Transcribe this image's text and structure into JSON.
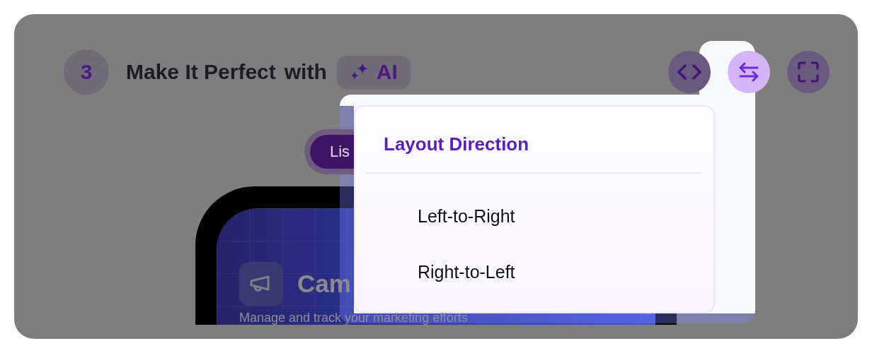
{
  "header": {
    "step": "3",
    "title": "Make It Perfect",
    "connector": "with",
    "badge": "AI"
  },
  "toolbar": [
    {
      "kind": "code",
      "selected": false
    },
    {
      "kind": "direction",
      "selected": true
    },
    {
      "kind": "fullscreen",
      "selected": false
    }
  ],
  "view_tabs": [
    {
      "label": "Lis",
      "selected": true
    }
  ],
  "preview": {
    "title": "Cam",
    "subtitle": "Manage and track your marketing efforts"
  },
  "menu": {
    "title": "Layout Direction",
    "options": [
      {
        "label": "Left-to-Right"
      },
      {
        "label": "Right-to-Left"
      }
    ]
  }
}
